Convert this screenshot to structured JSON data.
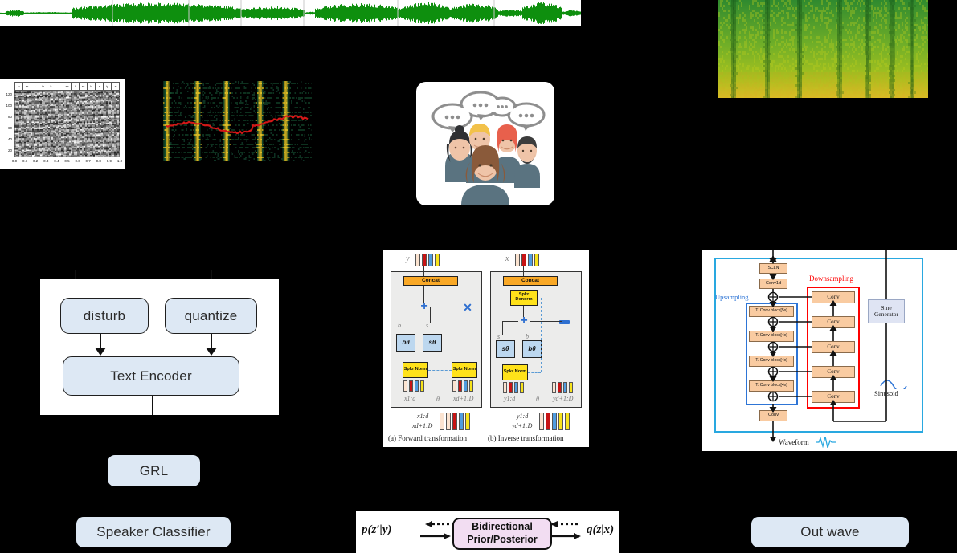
{
  "background_color": "#000000",
  "accent_colors": {
    "node_fill": "#dde8f4",
    "waveform_green": "#12a012",
    "pitch_red": "#d41717",
    "vocoder_upsampling_blue": "#2e75d6",
    "vocoder_downsampling_red": "#ff0000",
    "vocoder_border_blue": "#29a8e0",
    "flow_yellow": "#ffe21a",
    "flow_orange": "#f9a826",
    "flow_blue": "#bcd7ef",
    "bidir_fill": "#f2ddf2"
  },
  "inputs": {
    "waveform": {
      "name": "input-waveform",
      "caption": "",
      "color": "#12a012"
    },
    "mel_spectrogram": {
      "name": "mel-spectrogram",
      "caption": ""
    },
    "phoneme_plot": {
      "name": "phoneme-alignment-spectrogram",
      "phonemes": [
        "p",
        "er",
        "t",
        "ih",
        "k",
        "l",
        "ax",
        "l",
        "er",
        "b",
        "r",
        "iy",
        "z"
      ],
      "y_ticks": [
        "120",
        "100",
        "80",
        "60",
        "40",
        "20"
      ],
      "x_ticks": [
        "0.0",
        "0.1",
        "0.2",
        "0.3",
        "0.4",
        "0.5",
        "0.6",
        "0.7",
        "0.8",
        "0.9",
        "1.0"
      ]
    },
    "pitch_plot": {
      "name": "pitch-contour-spectrogram",
      "caption": ""
    },
    "speaker_icon": {
      "name": "speaker-group-icon",
      "caption": ""
    }
  },
  "text_encoder_panel": {
    "disturb": "disturb",
    "quantize": "quantize",
    "text_encoder": "Text Encoder"
  },
  "adversarial": {
    "grl": "GRL",
    "speaker_classifier": "Speaker Classifier"
  },
  "flow_module": {
    "title": "",
    "forward_caption": "(a) Forward transformation",
    "inverse_caption": "(b) Inverse transformation",
    "labels": {
      "concat": "Concat",
      "spkr_norm": "Spkr Norm",
      "spkr_denorm": "Spkr Denorm",
      "b_theta": "bθ",
      "s_theta": "sθ",
      "b": "b",
      "s": "s",
      "y": "y",
      "x": "x",
      "theta": "θ",
      "x_1d": "x1:d",
      "x_d1D": "xd+1:D",
      "y_1d": "y1:d",
      "y_d1D": "yd+1:D"
    }
  },
  "bidirectional": {
    "box_line1": "Bidirectional",
    "box_line2": "Prior/Posterior",
    "left_label": "p(z′|y)",
    "right_label": "q(z|x)"
  },
  "vocoder": {
    "upsampling_label": "Upsampling",
    "downsampling_label": "Downsampling",
    "sine_generator": "Sine Generator",
    "sinusoid_label": "Sinusoid",
    "waveform_label": "Waveform",
    "scln": "SCLN",
    "conv1d": "Conv1d",
    "conv": "Conv",
    "tconv_blocks": [
      "T. Conv block[5x]",
      "T. Conv block[4x]",
      "T. Conv block[4x]",
      "T. Conv block[4x]"
    ],
    "downsample_convs": [
      "Conv",
      "Conv",
      "Conv",
      "Conv",
      "Conv"
    ]
  },
  "output": {
    "out_wave": "Out wave"
  }
}
